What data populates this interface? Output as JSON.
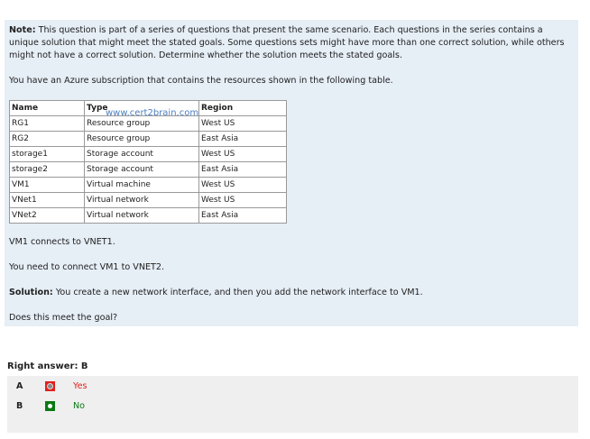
{
  "question": {
    "note_label": "Note:",
    "note_text": " This question is part of a series of questions that present the same scenario. Each questions in the series contains a unique solution that might meet the stated goals. Some questions sets might have more than one correct solution, while others might not have a correct solution. Determine whether the solution meets the stated goals.",
    "intro": "You have an Azure subscription that contains the resources shown in the following table.",
    "table": {
      "headers": [
        "Name",
        "Type",
        "Region"
      ],
      "rows": [
        [
          "RG1",
          "Resource group",
          "West US"
        ],
        [
          "RG2",
          "Resource group",
          "East Asia"
        ],
        [
          "storage1",
          "Storage account",
          "West US"
        ],
        [
          "storage2",
          "Storage account",
          "East Asia"
        ],
        [
          "VM1",
          "Virtual machine",
          "West US"
        ],
        [
          "VNet1",
          "Virtual network",
          "West US"
        ],
        [
          "VNet2",
          "Virtual network",
          "East Asia"
        ]
      ]
    },
    "watermark": "www.cert2brain.com",
    "line1": "VM1 connects to VNET1.",
    "line2": "You need to connect VM1 to VNET2.",
    "solution_label": "Solution:",
    "solution_text": " You create a new network interface, and then you add the network interface to VM1.",
    "goal": "Does this meet the goal?"
  },
  "answer": {
    "right_answer": "Right answer: B",
    "options": [
      {
        "letter": "A",
        "text": "Yes",
        "color": "#e0201c"
      },
      {
        "letter": "B",
        "text": "No",
        "color": "#0a7a12"
      }
    ]
  }
}
